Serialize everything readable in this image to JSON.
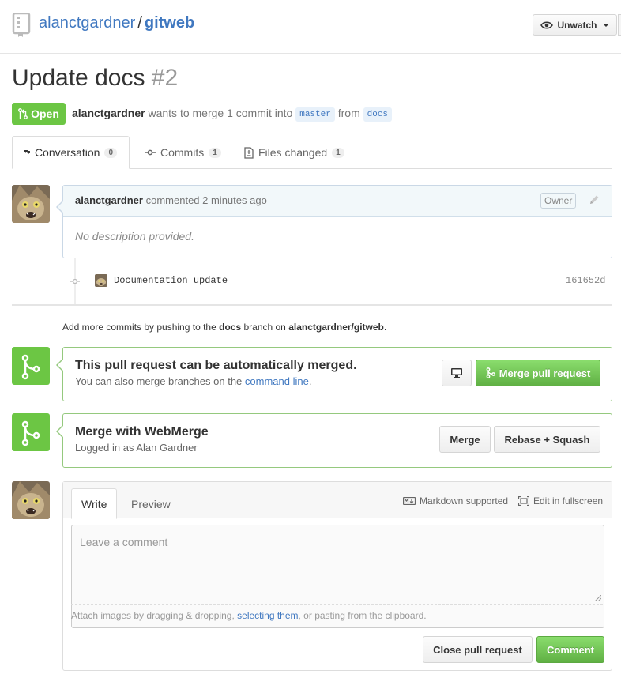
{
  "repo": {
    "owner": "alanctgardner",
    "separator": "/",
    "name": "gitweb",
    "watch_label": "Unwatch"
  },
  "pr": {
    "title": "Update docs",
    "number": "#2",
    "state": "Open",
    "author": "alanctgardner",
    "meta_text": "wants to merge 1 commit into",
    "base_branch": "master",
    "from_text": "from",
    "head_branch": "docs"
  },
  "tabs": [
    {
      "label": "Conversation",
      "count": "0"
    },
    {
      "label": "Commits",
      "count": "1"
    },
    {
      "label": "Files changed",
      "count": "1"
    }
  ],
  "comment": {
    "author": "alanctgardner",
    "action": "commented 2 minutes ago",
    "badge": "Owner",
    "body": "No description provided."
  },
  "commit": {
    "message": "Documentation update",
    "sha": "161652d"
  },
  "push_hint": {
    "prefix": "Add more commits by pushing to the",
    "branch": "docs",
    "middle": "branch on",
    "repo": "alanctgardner/gitweb",
    "suffix": "."
  },
  "merge_auto": {
    "title": "This pull request can be automatically merged.",
    "sub_prefix": "You can also merge branches on the",
    "sub_link": "command line",
    "sub_suffix": ".",
    "button": "Merge pull request"
  },
  "webmerge": {
    "title": "Merge with WebMerge",
    "sub": "Logged in as Alan Gardner",
    "merge_button": "Merge",
    "rebase_button": "Rebase + Squash"
  },
  "new_comment": {
    "tab_write": "Write",
    "tab_preview": "Preview",
    "markdown": "Markdown supported",
    "fullscreen": "Edit in fullscreen",
    "placeholder": "Leave a comment",
    "attach_prefix": "Attach images by dragging & dropping,",
    "attach_link": "selecting them",
    "attach_suffix": ", or pasting from the clipboard.",
    "close_button": "Close pull request",
    "comment_button": "Comment"
  },
  "colors": {
    "link": "#4078c0",
    "green": "#6cc644",
    "border_blue": "#cad8e6"
  }
}
